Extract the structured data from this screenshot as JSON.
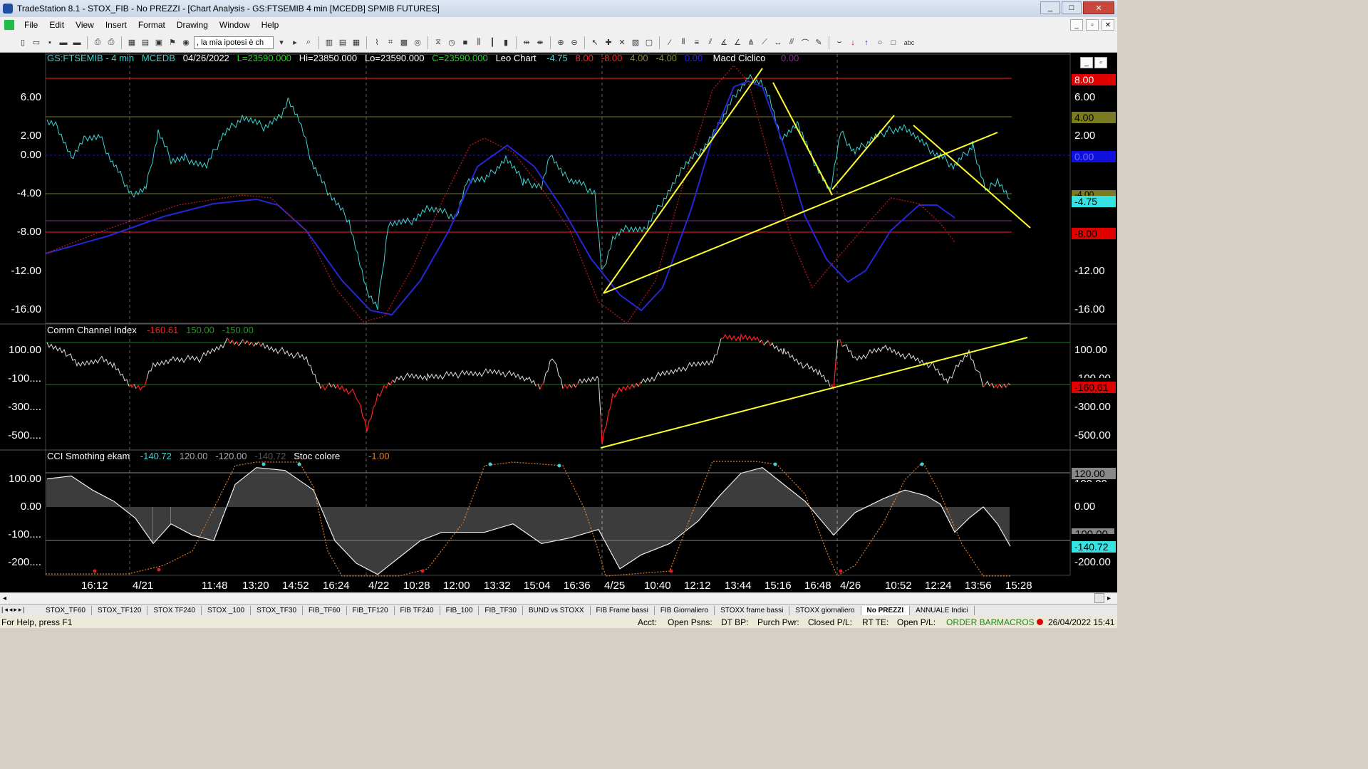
{
  "window": {
    "title": "TradeStation 8.1 - STOX_FIB - No PREZZI - [Chart Analysis - GS:FTSEMIB  4 min  [MCEDB] SPMIB FUTURES]",
    "minimize": "_",
    "maximize": "□",
    "close": "✕"
  },
  "menu": [
    "File",
    "Edit",
    "View",
    "Insert",
    "Format",
    "Drawing",
    "Window",
    "Help"
  ],
  "toolbar": {
    "combo_value": ", la mia ipotesi è ch"
  },
  "price_panel": {
    "symbol": "GS:FTSEMIB - 4 min",
    "datafeed": "MCEDB",
    "date": "04/26/2022",
    "last": "L=23590.000",
    "high": "Hi=23850.000",
    "low": "Lo=23590.000",
    "close": "C=23590.000",
    "indicator": "Leo Chart",
    "values": [
      "-4.75",
      "8.00",
      "-8.00",
      "4.00",
      "-4.00",
      "0.00"
    ],
    "macd_name": "Macd Ciclico",
    "macd_value": "0.00",
    "y_labels": [
      "6.00",
      "2.00",
      "0.00",
      "-4.00",
      "-8.00",
      "-12.00",
      "-16.00"
    ],
    "right_labels": [
      "6.00",
      "2.00",
      "-12.00",
      "-16.00"
    ],
    "tags": {
      "red_top": "8.00",
      "olive_top": "4.00",
      "blue_zero": "0.00",
      "olive_mid": "-4.00",
      "cyan_current": "-4.75",
      "red_bottom": "-8.00"
    }
  },
  "cci_panel": {
    "title": "Comm Channel Index",
    "v1": "-160.61",
    "v2": "150.00",
    "v3": "-150.00",
    "y_labels": [
      "100.00",
      "-100....",
      "-300....",
      "-500...."
    ],
    "right_labels": [
      "100.00",
      "-100.00",
      "-300.00",
      "-500.00"
    ],
    "current_tag": "-160.61"
  },
  "smooth_panel": {
    "title": "CCI Smothing ekam",
    "v1": "-140.72",
    "v2": "120.00",
    "v3": "-120.00",
    "v4": "-140.72",
    "stoc_name": "Stoc colore",
    "stoc_value": "-1.00",
    "y_labels": [
      "100.00",
      "0.00",
      "-100....",
      "-200...."
    ],
    "right_labels": [
      "100.00",
      "0.00",
      "-100.00",
      "-200.00"
    ],
    "tag_120": "120.00",
    "current_tag": "-140.72"
  },
  "x_labels": [
    "16:12",
    "4/21",
    "11:48",
    "13:20",
    "14:52",
    "16:24",
    "4/22",
    "10:28",
    "12:00",
    "13:32",
    "15:04",
    "16:36",
    "4/25",
    "10:40",
    "12:12",
    "13:44",
    "15:16",
    "16:48",
    "4/26",
    "10:52",
    "12:24",
    "13:56",
    "15:28"
  ],
  "tabs": [
    "STOX_TF60",
    "STOX_TF120",
    "STOX TF240",
    "STOX _100",
    "STOX_TF30",
    "FIB_TF60",
    "FIB_TF120",
    "FIB TF240",
    "FIB_100",
    "FIB_TF30",
    "BUND vs STOXX",
    "FIB Frame bassi",
    "FIB Giornaliero",
    "STOXX frame bassi",
    "STOXX giornaliero",
    "No PREZZI",
    "ANNUALE Indici"
  ],
  "active_tab": "No PREZZI",
  "status": {
    "help": "For Help, press F1",
    "acct": "Acct:",
    "open_psns": "Open Psns:",
    "dt_bp": "DT BP:",
    "purch_pwr": "Purch Pwr:",
    "closed_pl": "Closed P/L:",
    "rt_te": "RT TE:",
    "open_pl": "Open P/L:",
    "order_bar": "ORDER BAR",
    "macros": "MACROS",
    "datetime": "26/04/2022 15:41"
  },
  "colors": {
    "cyan": "#3fd2d2",
    "blue": "#2222cc",
    "red": "#ff2020",
    "dark_red": "#c81e1e",
    "yellow": "#ffff2a",
    "olive": "#7a7a20",
    "purple": "#8c2b8c",
    "green": "#1c7a1c"
  }
}
